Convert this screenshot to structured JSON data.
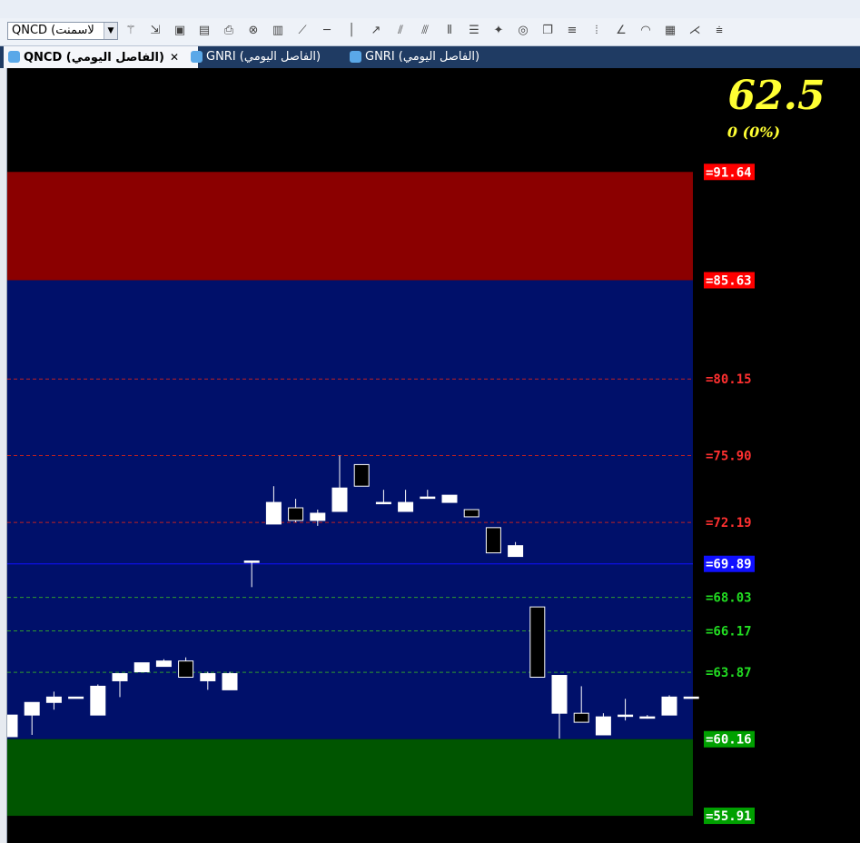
{
  "toolbar": {
    "symbol_value": "QNCD (لاسمنت",
    "icons": [
      "wand-icon",
      "import-icon",
      "add-chart-icon",
      "remove-chart-icon",
      "print-icon",
      "delete-icon",
      "indicator-icon",
      "line-tool-icon",
      "horizontal-line-icon",
      "vertical-line-icon",
      "ray-icon",
      "parallel-lines-icon",
      "channel-icon",
      "vertical-lines-icon",
      "levels-icon",
      "magnet-icon",
      "ellipse-icon",
      "copy-icon",
      "horizontal-levels-icon",
      "bars-icon",
      "gann-icon",
      "arc-icon",
      "grid-icon",
      "fan-icon",
      "fibo-icon"
    ]
  },
  "tabs": [
    {
      "label": "QNCD (الفاصل اليومي)",
      "active": true,
      "close": "✕"
    },
    {
      "label": "GNRI (الفاصل اليومي)",
      "active": false
    },
    {
      "label": "GNRI (الفاصل اليومي)",
      "active": false
    }
  ],
  "quote": {
    "last_price": "62.5",
    "change": "0 (0%)"
  },
  "chart_data": {
    "type": "candlestick",
    "ylim": [
      54.4,
      97.4
    ],
    "zones": [
      {
        "from": 85.63,
        "to": 91.64,
        "color": "#8b0000"
      },
      {
        "from": 60.16,
        "to": 85.63,
        "color": "#00106a"
      },
      {
        "from": 55.91,
        "to": 60.16,
        "color": "#005500"
      }
    ],
    "levels": [
      {
        "value": 91.64,
        "label": "=91.64",
        "color": "#ff0000",
        "style": "box"
      },
      {
        "value": 85.63,
        "label": "=85.63",
        "color": "#ff0000",
        "style": "box"
      },
      {
        "value": 80.15,
        "label": "=80.15",
        "color": "#ff3030",
        "style": "dashed"
      },
      {
        "value": 75.9,
        "label": "=75.90",
        "color": "#ff3030",
        "style": "dashed"
      },
      {
        "value": 72.19,
        "label": "=72.19",
        "color": "#ff3030",
        "style": "dashed"
      },
      {
        "value": 69.89,
        "label": "=69.89",
        "color": "#1010ff",
        "style": "solid"
      },
      {
        "value": 68.03,
        "label": "=68.03",
        "color": "#22dd22",
        "style": "dashed"
      },
      {
        "value": 66.17,
        "label": "=66.17",
        "color": "#22dd22",
        "style": "dashed"
      },
      {
        "value": 63.87,
        "label": "=63.87",
        "color": "#22dd22",
        "style": "dashed"
      },
      {
        "value": 60.16,
        "label": "=60.16",
        "color": "#00a000",
        "style": "box"
      },
      {
        "value": 55.91,
        "label": "=55.91",
        "color": "#00a000",
        "style": "box"
      }
    ],
    "candles": [
      {
        "o": 60.3,
        "h": 61.5,
        "l": 60.3,
        "c": 61.5
      },
      {
        "o": 61.5,
        "h": 62.2,
        "l": 60.4,
        "c": 62.2
      },
      {
        "o": 62.2,
        "h": 62.8,
        "l": 61.8,
        "c": 62.5
      },
      {
        "o": 62.5,
        "h": 62.5,
        "l": 62.5,
        "c": 62.5
      },
      {
        "o": 61.5,
        "h": 63.2,
        "l": 61.5,
        "c": 63.1
      },
      {
        "o": 63.4,
        "h": 63.8,
        "l": 62.5,
        "c": 63.8
      },
      {
        "o": 63.9,
        "h": 64.4,
        "l": 63.9,
        "c": 64.4
      },
      {
        "o": 64.2,
        "h": 64.6,
        "l": 64.2,
        "c": 64.5
      },
      {
        "o": 64.5,
        "h": 64.7,
        "l": 63.6,
        "c": 63.6
      },
      {
        "o": 63.4,
        "h": 63.9,
        "l": 62.9,
        "c": 63.8
      },
      {
        "o": 62.9,
        "h": 63.9,
        "l": 62.9,
        "c": 63.8
      },
      {
        "o": 69.97,
        "h": 70.05,
        "l": 68.6,
        "c": 70.05
      },
      {
        "o": 72.1,
        "h": 74.2,
        "l": 72.1,
        "c": 73.3
      },
      {
        "o": 73.0,
        "h": 73.5,
        "l": 72.2,
        "c": 72.3
      },
      {
        "o": 72.3,
        "h": 72.9,
        "l": 72.0,
        "c": 72.7
      },
      {
        "o": 72.8,
        "h": 75.9,
        "l": 72.8,
        "c": 74.1
      },
      {
        "o": 75.4,
        "h": 75.4,
        "l": 74.2,
        "c": 74.2
      },
      {
        "o": 73.3,
        "h": 74.0,
        "l": 73.2,
        "c": 73.3
      },
      {
        "o": 72.8,
        "h": 74.0,
        "l": 72.8,
        "c": 73.3
      },
      {
        "o": 73.6,
        "h": 74.0,
        "l": 73.5,
        "c": 73.6
      },
      {
        "o": 73.3,
        "h": 73.7,
        "l": 73.3,
        "c": 73.7
      },
      {
        "o": 72.9,
        "h": 72.9,
        "l": 72.5,
        "c": 72.5
      },
      {
        "o": 71.9,
        "h": 71.9,
        "l": 70.5,
        "c": 70.5
      },
      {
        "o": 70.3,
        "h": 71.1,
        "l": 70.3,
        "c": 70.9
      },
      {
        "o": 67.5,
        "h": 67.5,
        "l": 63.6,
        "c": 63.6
      },
      {
        "o": 61.6,
        "h": 63.7,
        "l": 60.2,
        "c": 63.7
      },
      {
        "o": 61.6,
        "h": 63.1,
        "l": 61.1,
        "c": 61.1
      },
      {
        "o": 60.4,
        "h": 61.6,
        "l": 60.4,
        "c": 61.4
      },
      {
        "o": 61.5,
        "h": 62.4,
        "l": 61.2,
        "c": 61.5
      },
      {
        "o": 61.4,
        "h": 61.5,
        "l": 61.3,
        "c": 61.4
      },
      {
        "o": 61.5,
        "h": 62.6,
        "l": 61.5,
        "c": 62.5
      },
      {
        "o": 62.5,
        "h": 62.5,
        "l": 62.5,
        "c": 62.5
      }
    ]
  }
}
